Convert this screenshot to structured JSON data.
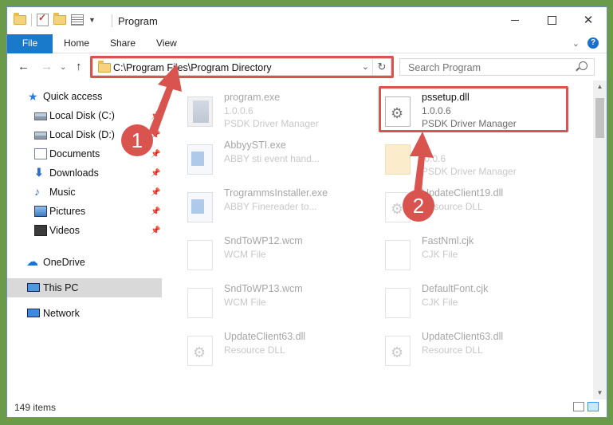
{
  "window": {
    "title": "Program"
  },
  "ribbon": {
    "tabs": [
      "File",
      "Home",
      "Share",
      "View"
    ]
  },
  "address": {
    "path": "C:\\Program Files\\Program Directory"
  },
  "search": {
    "placeholder": "Search Program"
  },
  "sidebar": {
    "items": [
      {
        "label": "Quick access",
        "icon": "star-icon",
        "pinned": false
      },
      {
        "label": "Local Disk (C:)",
        "icon": "drive-icon",
        "pinned": true
      },
      {
        "label": "Local Disk (D:)",
        "icon": "drive-icon",
        "pinned": true
      },
      {
        "label": "Documents",
        "icon": "documents-icon",
        "pinned": true
      },
      {
        "label": "Downloads",
        "icon": "downloads-icon",
        "pinned": true
      },
      {
        "label": "Music",
        "icon": "music-icon",
        "pinned": true
      },
      {
        "label": "Pictures",
        "icon": "pictures-icon",
        "pinned": true
      },
      {
        "label": "Videos",
        "icon": "videos-icon",
        "pinned": true
      },
      {
        "label": "OneDrive",
        "icon": "onedrive-icon",
        "pinned": false
      },
      {
        "label": "This PC",
        "icon": "this-pc-icon",
        "pinned": false,
        "selected": true
      },
      {
        "label": "Network",
        "icon": "network-icon",
        "pinned": false
      }
    ]
  },
  "files": [
    {
      "name": "program.exe",
      "line2": "1.0.0.6",
      "line3": "PSDK Driver Manager",
      "type": "setup"
    },
    {
      "name": "pssetup.dll",
      "line2": "1.0.0.6",
      "line3": "PSDK Driver Manager",
      "type": "dll",
      "highlighted": true
    },
    {
      "name": "AbbyySTI.exe",
      "line2": "ABBY sti event hand...",
      "line3": "",
      "type": "exe"
    },
    {
      "name": "ll",
      "line2": ".0.0.6",
      "line3": "PSDK Driver Manager",
      "type": "folder"
    },
    {
      "name": "TrogrammsInstaller.exe",
      "line2": "ABBY Finereader to...",
      "line3": "",
      "type": "exe"
    },
    {
      "name": "UpdateClient19.dll",
      "line2": "Resource DLL",
      "line3": "",
      "type": "dll"
    },
    {
      "name": "SndToWP12.wcm",
      "line2": "WCM File",
      "line3": "",
      "type": "doc"
    },
    {
      "name": "FastNml.cjk",
      "line2": "CJK File",
      "line3": "",
      "type": "doc"
    },
    {
      "name": "SndToWP13.wcm",
      "line2": "WCM File",
      "line3": "",
      "type": "doc"
    },
    {
      "name": "DefaultFont.cjk",
      "line2": "CJK File",
      "line3": "",
      "type": "doc"
    },
    {
      "name": "UpdateClient63.dll",
      "line2": "Resource DLL",
      "line3": "",
      "type": "dll"
    },
    {
      "name": "UpdateClient63.dll",
      "line2": "Resource DLL",
      "line3": "",
      "type": "dll"
    }
  ],
  "status": {
    "item_count": "149 items"
  },
  "annotations": {
    "badge1": "1",
    "badge2": "2",
    "color": "#d9534f"
  },
  "colors": {
    "file_tab": "#1979ca",
    "selection": "#d9d9d9"
  }
}
